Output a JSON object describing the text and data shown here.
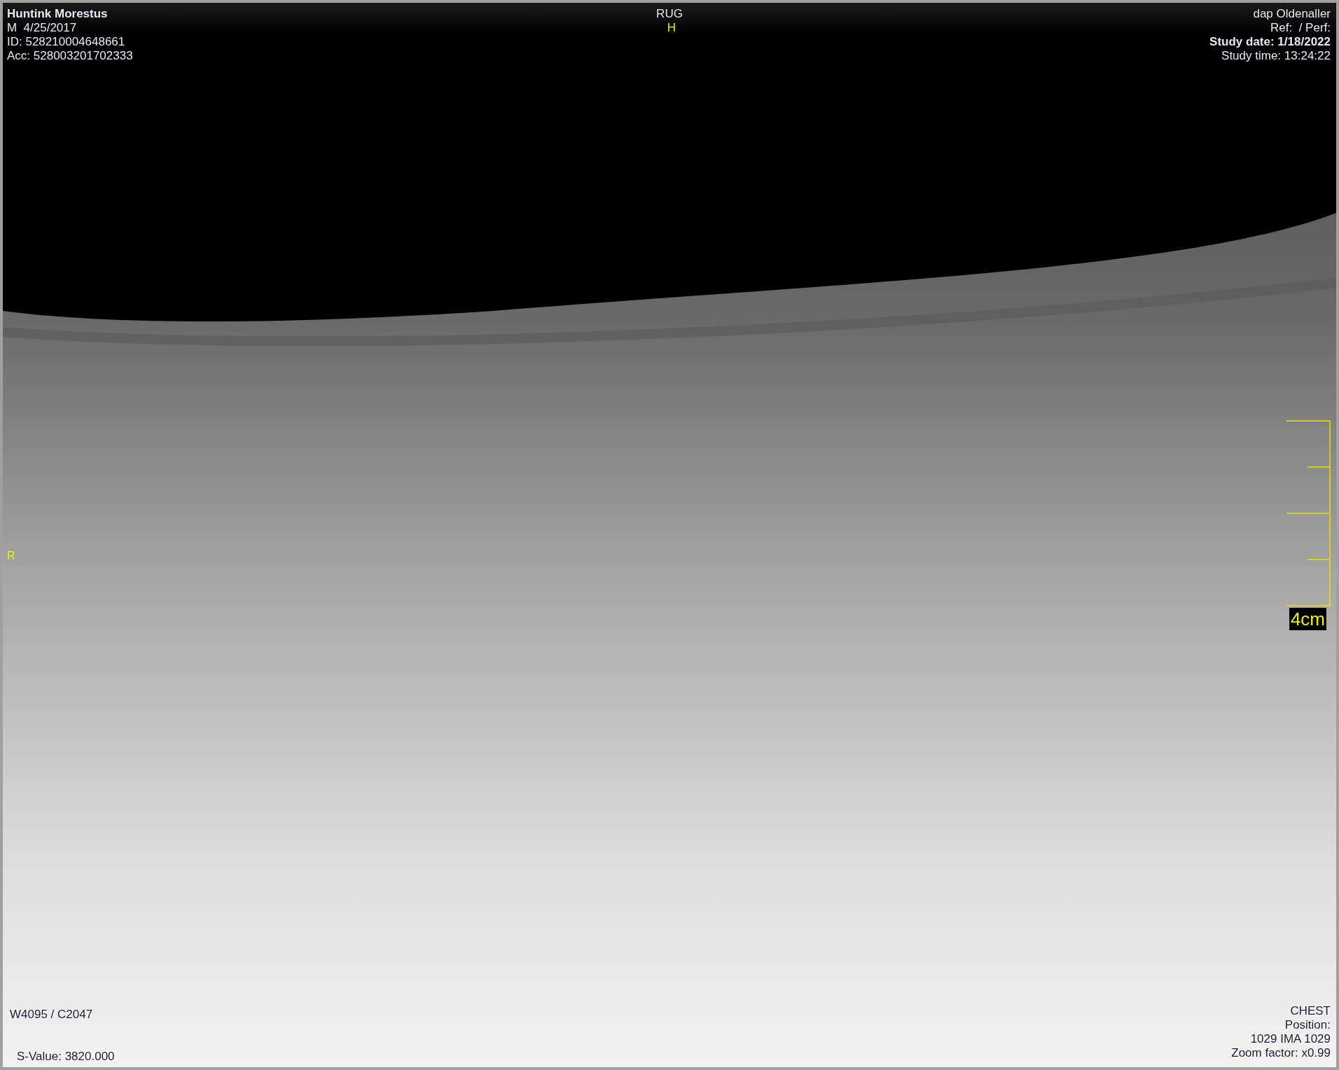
{
  "overlay": {
    "top_left": [
      {
        "text": "Huntink Morestus",
        "bold": true
      },
      {
        "text": "M  4/25/2017",
        "bold": false
      },
      {
        "text": "ID: 528210004648661",
        "bold": false
      },
      {
        "text": "Acc: 528003201702333",
        "bold": false
      }
    ],
    "top_center": "RUG",
    "top_right": [
      {
        "text": "dap Oldenaller",
        "bold": false
      },
      {
        "text": "Ref:  / Perf:",
        "bold": false
      },
      {
        "text": "Study date: 1/18/2022",
        "bold": true
      },
      {
        "text": "Study time: 13:24:22",
        "bold": false
      }
    ],
    "orientation_top": "H",
    "orientation_left": "R",
    "scale_label": "4cm",
    "window_level": "W4095 / C2047",
    "s_value": "S-Value: 3820.000",
    "bottom_right": [
      "CHEST",
      "Position:",
      "1029 IMA 1029",
      "Zoom factor: x0.99"
    ]
  }
}
